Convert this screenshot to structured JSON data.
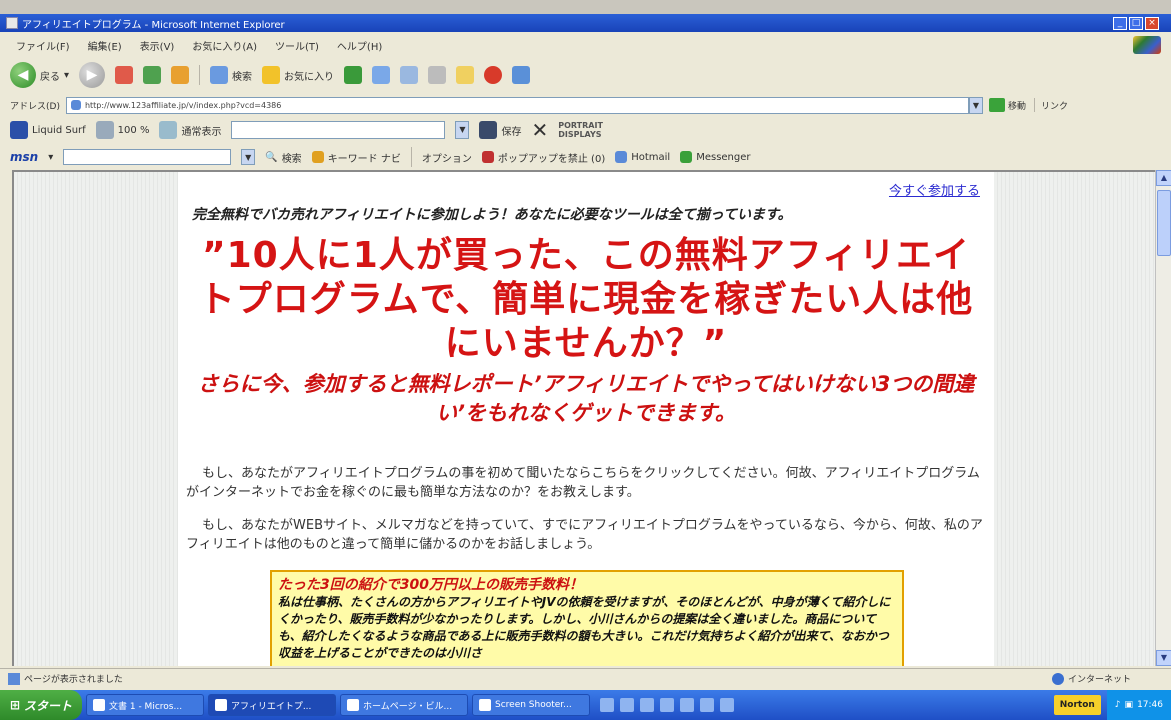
{
  "window": {
    "title": "アフィリエイトプログラム - Microsoft Internet Explorer"
  },
  "menu": [
    "ファイル(F)",
    "編集(E)",
    "表示(V)",
    "お気に入り(A)",
    "ツール(T)",
    "ヘルプ(H)"
  ],
  "toolbar": {
    "back_label": "戻る",
    "search_label": "検索",
    "favorites_label": "お気に入り"
  },
  "address": {
    "label": "アドレス(D)",
    "url": "http://www.123affiliate.jp/v/index.php?vcd=4386",
    "go_label": "移動",
    "links_label": "リンク"
  },
  "toolbar2": {
    "liquid_surf": "Liquid Surf",
    "zoom": "100 %",
    "view_mode": "通常表示",
    "save_label": "保存",
    "portrait_label": "PORTRAIT DISPLAYS"
  },
  "msn_bar": {
    "search_label": "検索",
    "keyword_label": "キーワード ナビ",
    "options_label": "オプション",
    "popup_label": "ポップアップを禁止 (0)",
    "hotmail_label": "Hotmail",
    "messenger_label": "Messenger"
  },
  "page": {
    "join_link": "今すぐ参加する",
    "intro": "完全無料でバカ売れアフィリエイトに参加しよう！あなたに必要なツールは全て揃っています。",
    "headline": "”10人に1人が買った、この無料アフィリエイトプログラムで、簡単に現金を稼ぎたい人は他にいませんか？”",
    "subheadline": "さらに今、参加すると無料レポート’アフィリエイトでやってはいけない3つの間違い’をもれなくゲットできます。",
    "para1": "もし、あなたがアフィリエイトプログラムの事を初めて聞いたならこちらをクリックしてください。何故、アフィリエイトプログラムがインターネットでお金を稼ぐのに最も簡単な方法なのか？をお教えします。",
    "para2": "もし、あなたがWEBサイト、メルマガなどを持っていて、すでにアフィリエイトプログラムをやっているなら、今から、何故、私のアフィリエイトは他のものと違って簡単に儲かるのかをお話しましょう。",
    "callout_title": "たった3回の紹介で300万円以上の販売手数料！",
    "callout_body": "私は仕事柄、たくさんの方からアフィリエイトやJVの依頼を受けますが、そのほとんどが、中身が薄くて紹介しにくかったり、販売手数料が少なかったりします。しかし、小川さんからの提案は全く違いました。商品についても、紹介したくなるような商品である上に販売手数料の額も大きい。これだけ気持ちよく紹介が出来て、なおかつ収益を上げることができたのは小川さ"
  },
  "status": {
    "text": "ページが表示されました",
    "zone": "インターネット"
  },
  "taskbar": {
    "start": "スタート",
    "tasks": [
      "文書 1 - Micros...",
      "アフィリエイトプ...",
      "ホームページ・ビル...",
      "Screen Shooter..."
    ],
    "norton": "Norton",
    "clock": "17:46"
  }
}
